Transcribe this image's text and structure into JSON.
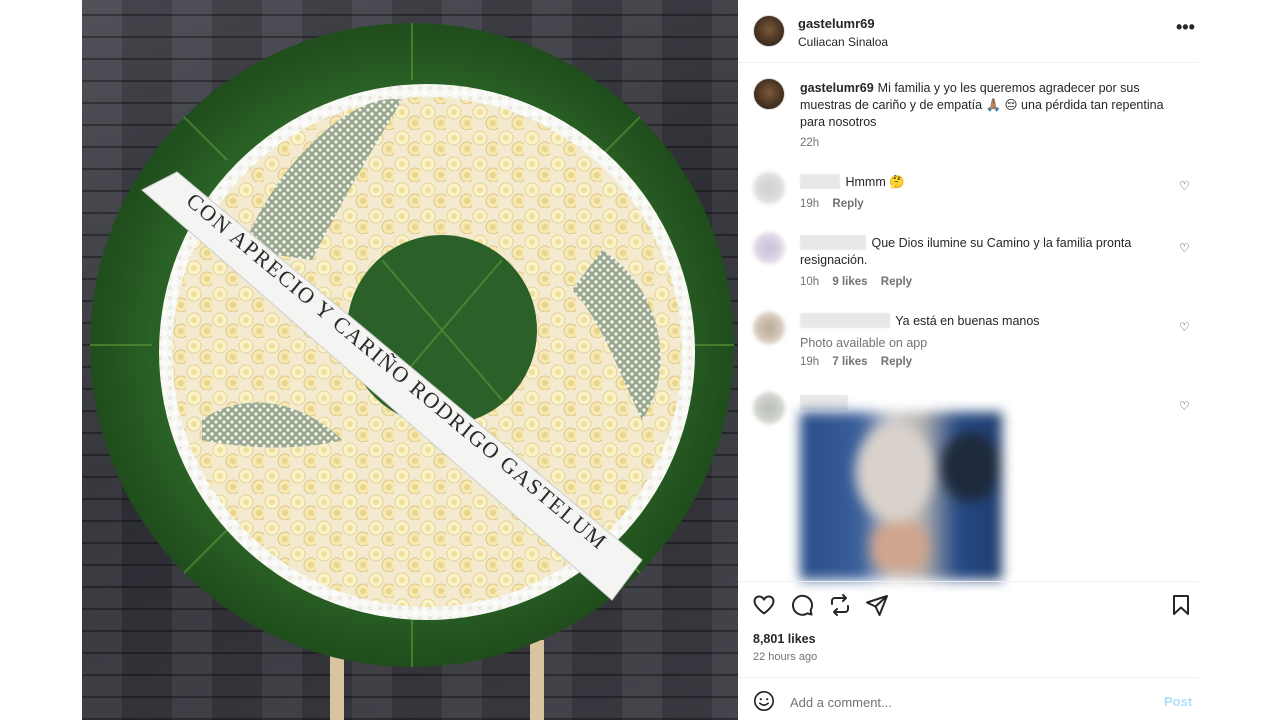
{
  "post": {
    "username": "gastelumr69",
    "location": "Culiacan Sinaloa",
    "ribbon_text": "CON APRECIO Y CARIÑO RODRIGO GASTELUM",
    "caption": {
      "username": "gastelumr69",
      "text": "Mi familia y yo les queremos agradecer por sus muestras de cariño y de empatía 🙏🏽 😔  una pérdida tan repentina para nosotros",
      "time": "22h"
    }
  },
  "comments": [
    {
      "text": "Hmmm 🤔",
      "time": "19h",
      "likes": "",
      "reply_label": "Reply"
    },
    {
      "text": "Que Dios ilumine su Camino y la familia pronta resignación.",
      "time": "10h",
      "likes": "9 likes",
      "reply_label": "Reply"
    },
    {
      "text": "Ya está en buenas manos",
      "subtext": "Photo available on app",
      "time": "19h",
      "likes": "7 likes",
      "reply_label": "Reply"
    },
    {
      "text": ""
    }
  ],
  "actions": {
    "like_icon": "heart-icon",
    "comment_icon": "comment-icon",
    "share_icon": "repost-icon",
    "send_icon": "send-icon",
    "save_icon": "bookmark-icon"
  },
  "stats": {
    "likes": "8,801 likes",
    "time_ago": "22 hours ago"
  },
  "composer": {
    "placeholder": "Add a comment...",
    "post_label": "Post",
    "post_color": "#b2dffc"
  },
  "colors": {
    "text": "#262626",
    "secondary": "#737373"
  }
}
